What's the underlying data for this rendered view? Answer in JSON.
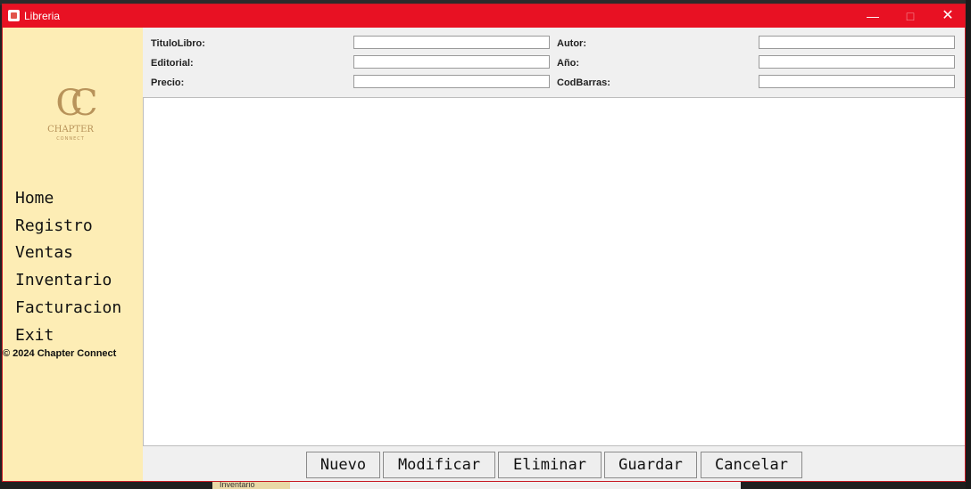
{
  "window": {
    "title": "Libreria",
    "close_glyph": "✕",
    "minimize_glyph": "—",
    "maximize_glyph": "□"
  },
  "logo": {
    "monogram": "CC",
    "name": "CHAPTER",
    "tagline": "CONNECT",
    "color": "#b8935a"
  },
  "sidebar": {
    "items": [
      {
        "label": "Home"
      },
      {
        "label": "Registro"
      },
      {
        "label": "Ventas"
      },
      {
        "label": "Inventario"
      },
      {
        "label": "Facturacion"
      },
      {
        "label": "Exit"
      }
    ],
    "copyright": "© 2024 Chapter Connect"
  },
  "form": {
    "titulo_label": "TituloLibro:",
    "titulo_value": "",
    "autor_label": "Autor:",
    "autor_value": "",
    "editorial_label": "Editorial:",
    "editorial_value": "",
    "anio_label": "Año:",
    "anio_value": "",
    "precio_label": "Precio:",
    "precio_value": "",
    "codbarras_label": "CodBarras:",
    "codbarras_value": ""
  },
  "actions": {
    "nuevo": "Nuevo",
    "modificar": "Modificar",
    "eliminar": "Eliminar",
    "guardar": "Guardar",
    "cancelar": "Cancelar"
  },
  "background": {
    "taskbar_tab": "Inventario"
  },
  "colors": {
    "titlebar": "#e81123",
    "sidebar": "#fdedb5",
    "window": "#f0f0f0"
  }
}
